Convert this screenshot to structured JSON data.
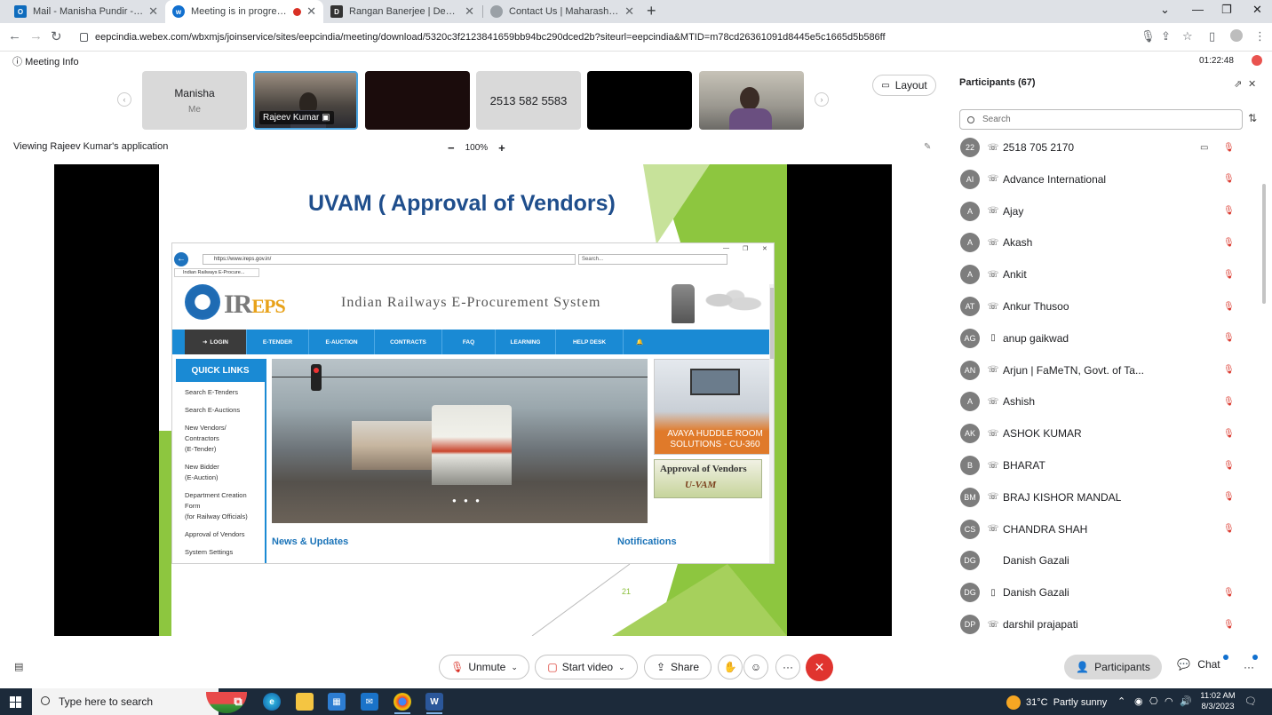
{
  "browser": {
    "tabs": [
      {
        "title": "Mail - Manisha Pundir - Outlook",
        "icon": "outlook-icon",
        "color": "#0f6cbd",
        "active": false
      },
      {
        "title": "Meeting is in progress...",
        "icon": "webex-icon",
        "color": "#1170cf",
        "active": true
      },
      {
        "title": "Rangan Banerjee | Department o",
        "icon": "iitd-icon",
        "color": "#333333",
        "active": false
      },
      {
        "title": "Contact Us | Maharashtra Energy",
        "icon": "globe-icon",
        "color": "#9aa0a6",
        "active": false
      }
    ],
    "url": "eepcindia.webex.com/wbxmjs/joinservice/sites/eepcindia/meeting/download/5320c3f2123841659bb94bc290dced2b?siteurl=eepcindia&MTID=m78cd26361091d8445e5c1665d5b586ff"
  },
  "meeting": {
    "info_label": "Meeting Info",
    "elapsed": "01:22:48",
    "layout_label": "Layout",
    "viewing_text": "Viewing Rajeev Kumar's application",
    "zoom": "100%",
    "tiles": [
      {
        "name": "Manisha",
        "sub": "Me",
        "kind": "grey"
      },
      {
        "name": "Rajeev Kumar",
        "kind": "video1"
      },
      {
        "kind": "dark"
      },
      {
        "name": "2513 582 5583",
        "kind": "phone"
      },
      {
        "kind": "black"
      },
      {
        "kind": "video2"
      }
    ]
  },
  "slide": {
    "title": "UVAM ( Approval of Vendors)",
    "page": "21",
    "browser": {
      "url": "https://www.ireps.gov.in/",
      "search": "Search...",
      "tab": "Indian Railways E-Procure..."
    },
    "ireps": {
      "logo_main": "IR",
      "logo_accent": "EPS",
      "name": "Indian Railways E-Procurement System",
      "nav": [
        "LOGIN",
        "E-TENDER",
        "E-AUCTION",
        "CONTRACTS",
        "FAQ",
        "LEARNING",
        "HELP DESK"
      ],
      "quick_title": "QUICK LINKS",
      "quick_links": [
        "Search E-Tenders",
        "Search E-Auctions",
        "New Vendors/\nContractors\n(E-Tender)",
        "New Bidder\n(E-Auction)",
        "Department Creation\nForm\n(for Railway Officials)",
        "Approval of Vendors",
        "System Settings"
      ],
      "avaya": "AVAYA HUDDLE ROOM SOLUTIONS - CU-360",
      "uvam_title": "Approval of Vendors",
      "uvam_sub": "U-VAM",
      "news": "News & Updates",
      "notifications": "Notifications"
    }
  },
  "participants": {
    "title": "Participants (67)",
    "search_placeholder": "Search",
    "list": [
      {
        "initials": "22",
        "name": "2518 705 2170",
        "device": "phone",
        "muted": true,
        "video": true
      },
      {
        "initials": "AI",
        "name": "Advance International",
        "device": "phone",
        "muted": true
      },
      {
        "initials": "A",
        "name": "Ajay",
        "device": "phone",
        "muted": true
      },
      {
        "initials": "A",
        "name": "Akash",
        "device": "phone",
        "muted": true
      },
      {
        "initials": "A",
        "name": "Ankit",
        "device": "phone",
        "muted": true
      },
      {
        "initials": "AT",
        "name": "Ankur Thusoo",
        "device": "phone",
        "muted": true
      },
      {
        "initials": "AG",
        "name": "anup gaikwad",
        "device": "mobile",
        "muted": true
      },
      {
        "initials": "AN",
        "name": "Arjun | FaMeTN, Govt. of Ta...",
        "device": "phone",
        "muted": true
      },
      {
        "initials": "A",
        "name": "Ashish",
        "device": "phone",
        "muted": true
      },
      {
        "initials": "AK",
        "name": "ASHOK KUMAR",
        "device": "phone",
        "muted": true
      },
      {
        "initials": "B",
        "name": "BHARAT",
        "device": "phone",
        "muted": true
      },
      {
        "initials": "BM",
        "name": "BRAJ KISHOR MANDAL",
        "device": "phone",
        "muted": true
      },
      {
        "initials": "CS",
        "name": "CHANDRA SHAH",
        "device": "phone",
        "muted": true
      },
      {
        "initials": "DG",
        "name": "Danish Gazali",
        "device": "none",
        "muted": false
      },
      {
        "initials": "DG",
        "name": "Danish Gazali",
        "device": "mobile",
        "muted": true
      },
      {
        "initials": "DP",
        "name": "darshil prajapati",
        "device": "phone",
        "muted": true
      }
    ]
  },
  "controls": {
    "unmute": "Unmute",
    "start_video": "Start video",
    "share": "Share",
    "participants": "Participants",
    "chat": "Chat"
  },
  "taskbar": {
    "search_placeholder": "Type here to search",
    "weather": "31°C  Partly sunny",
    "time": "11:02 AM",
    "date": "8/3/2023"
  }
}
